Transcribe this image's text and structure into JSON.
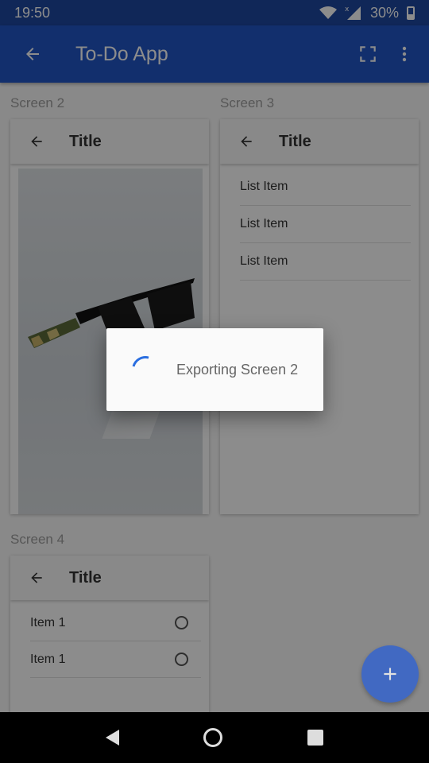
{
  "status_bar": {
    "time": "19:50",
    "battery": "30%"
  },
  "app_bar": {
    "title": "To-Do App"
  },
  "screens": {
    "screen2": {
      "label": "Screen 2",
      "title": "Title"
    },
    "screen3": {
      "label": "Screen 3",
      "title": "Title",
      "items": [
        "List Item",
        "List Item",
        "List Item"
      ]
    },
    "screen4": {
      "label": "Screen 4",
      "title": "Title",
      "items": [
        "Item 1",
        "Item 1"
      ]
    }
  },
  "dialog": {
    "message": "Exporting Screen 2"
  },
  "colors": {
    "status_bar": "#1e47a1",
    "app_bar": "#2256c6",
    "fab": "#2a5fd6",
    "spinner": "#2a6ee0"
  },
  "icons": [
    "wifi-icon",
    "signal-icon",
    "battery-icon",
    "back-arrow-icon",
    "fullscreen-icon",
    "more-vert-icon",
    "add-icon",
    "nav-back-icon",
    "nav-home-icon",
    "nav-recents-icon",
    "radio-icon"
  ]
}
